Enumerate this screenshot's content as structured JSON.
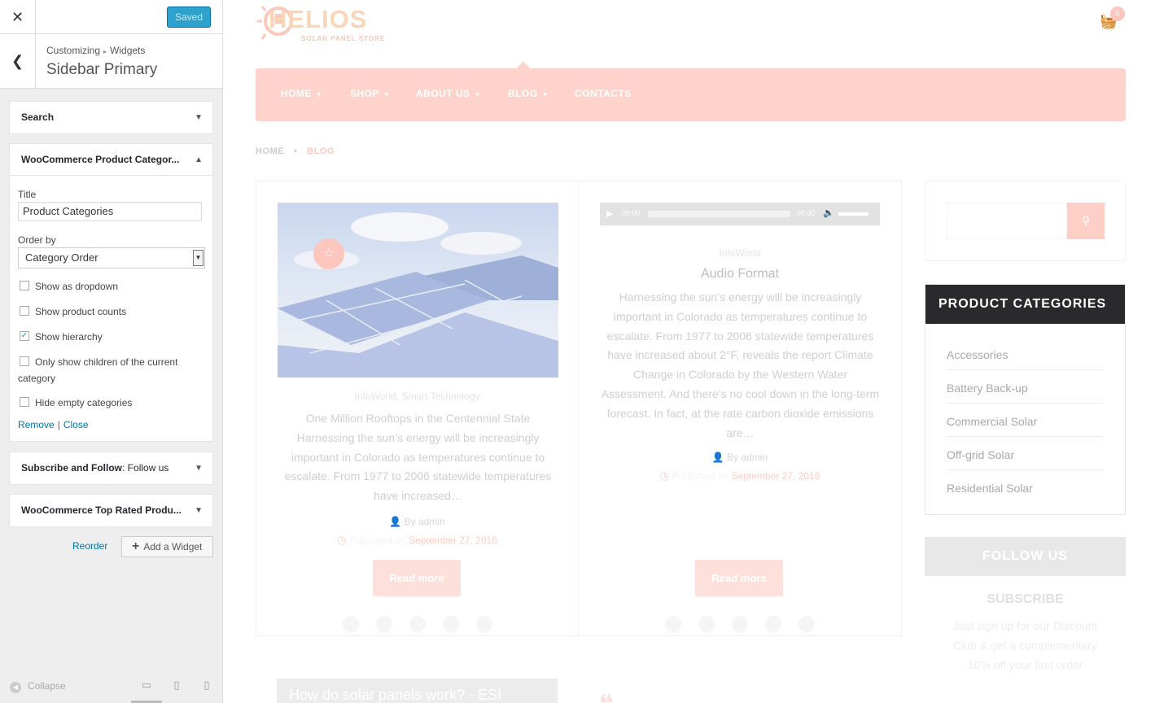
{
  "colors": {
    "accent": "#fdd3cb",
    "saved_blue": "#2ea2cc",
    "dark_head": "#2a2a2d",
    "link": "#0073aa"
  },
  "customizer": {
    "saved_label": "Saved",
    "close_icon": "close-icon",
    "back_icon": "back-arrow-icon",
    "breadcrumb": {
      "root": "Customizing",
      "leaf": "Widgets"
    },
    "title": "Sidebar Primary",
    "widgets": {
      "search": {
        "label": "Search"
      },
      "categories": {
        "label": "WooCommerce Product Categor...",
        "title_label": "Title",
        "title_value": "Product Categories",
        "orderby_label": "Order by",
        "orderby_value": "Category Order",
        "options": [
          {
            "label": "Show as dropdown",
            "checked": false
          },
          {
            "label": "Show product counts",
            "checked": false
          },
          {
            "label": "Show hierarchy",
            "checked": true
          },
          {
            "label": "Only show children of the current category",
            "checked": false
          },
          {
            "label": "Hide empty categories",
            "checked": false
          }
        ],
        "remove_label": "Remove",
        "close_label": "Close"
      },
      "subscribe": {
        "label": "Subscribe and Follow",
        "sub": ": Follow us"
      },
      "toprated": {
        "label": "WooCommerce Top Rated Produ..."
      }
    },
    "reorder_label": "Reorder",
    "add_widget_label": "Add a Widget",
    "collapse_label": "Collapse"
  },
  "site": {
    "logo": {
      "name": "HELIOS",
      "tagline": "SOLAR PANEL STORE"
    },
    "cart_count": "0",
    "nav": [
      "HOME",
      "SHOP",
      "ABOUT US",
      "BLOG",
      "CONTACTS"
    ],
    "breadcrumb": {
      "home": "HOME",
      "current": "BLOG"
    },
    "posts": [
      {
        "categories": "InfoWorld, Smart Technology",
        "excerpt": "One Million Rooftops in the Centennial State Harnessing the sun’s energy will be increasingly important in Colorado as temperatures continue to escalate. From 1977 to 2006 statewide temperatures have increased…",
        "author": "By admin",
        "published": "Published on ",
        "date": "September 27, 2016",
        "read_more": "Read more"
      },
      {
        "categories": "InfoWorld",
        "title": "Audio Format",
        "excerpt": "Harnessing the sun’s energy will be increasingly important in Colorado as temperatures continue to escalate. From 1977 to 2006 statewide temperatures have increased about 2°F, reveals the report Climate Change in Colorado by the Western Water Assessment. And there’s no cool down in the long-term forecast. In fact, at the rate carbon dioxide emissions are…",
        "author": "By admin",
        "published": "Published on ",
        "date": "September 27, 2016",
        "read_more": "Read more",
        "audio": {
          "current": "00:00",
          "duration": "00:00"
        }
      }
    ],
    "sidebar": {
      "categories_title": "PRODUCT CATEGORIES",
      "categories": [
        "Accessories",
        "Battery Back-up",
        "Commercial Solar",
        "Off-grid Solar",
        "Residential Solar"
      ],
      "follow_title": "FOLLOW US",
      "subscribe_title": "SUBSCRIBE",
      "subscribe_text": "Just sign up for our Discount Club & get a complementary 10% off your first order"
    },
    "bottom_strip_text": "How do solar panels work? - ESI"
  }
}
